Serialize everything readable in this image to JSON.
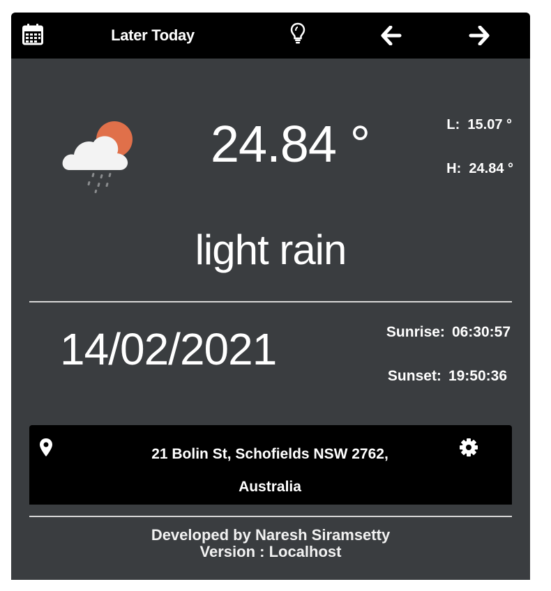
{
  "header": {
    "title": "Later Today",
    "icons": [
      "calendar-icon",
      "lightbulb-icon",
      "arrow-left-icon",
      "arrow-right-icon"
    ]
  },
  "current": {
    "icon": "cloud-sun-rain-icon",
    "temperature": "24.84 °",
    "low_label": "L:",
    "low_value": "15.07 °",
    "high_label": "H:",
    "high_value": "24.84 °",
    "description": "light rain"
  },
  "day": {
    "date": "14/02/2021",
    "sunrise_label": "Sunrise:",
    "sunrise_value": "06:30:57",
    "sunset_label": "Sunset:",
    "sunset_value": "19:50:36"
  },
  "location": {
    "address_line1": "21 Bolin St, Schofields NSW 2762,",
    "address_line2": "Australia",
    "icons": [
      "map-pin-icon",
      "gear-icon"
    ]
  },
  "footer": {
    "developer": "Developed by Naresh Siramsetty",
    "version": "Version : Localhost"
  },
  "colors": {
    "panel": "#3a3d40",
    "bar": "#000000",
    "sun": "#e0704a",
    "text": "#ffffff"
  }
}
